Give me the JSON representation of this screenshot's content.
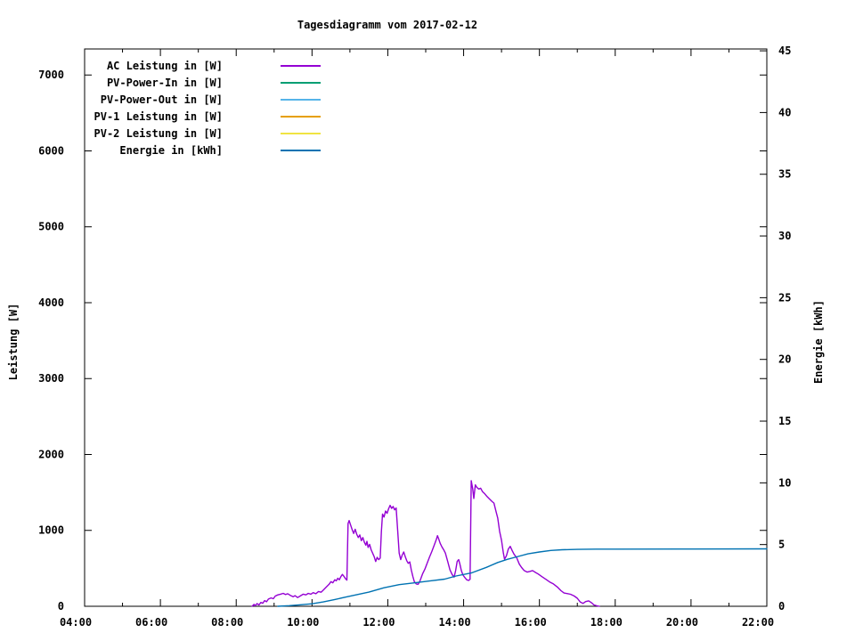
{
  "chart_data": {
    "type": "line",
    "title": "Tagesdiagramm vom 2017-02-12",
    "x_axis": {
      "range": [
        4,
        22
      ],
      "major_ticks": [
        {
          "h": 4,
          "label": "04:00"
        },
        {
          "h": 6,
          "label": "06:00"
        },
        {
          "h": 8,
          "label": "08:00"
        },
        {
          "h": 10,
          "label": "10:00"
        },
        {
          "h": 12,
          "label": "12:00"
        },
        {
          "h": 14,
          "label": "14:00"
        },
        {
          "h": 16,
          "label": "16:00"
        },
        {
          "h": 18,
          "label": "18:00"
        },
        {
          "h": 20,
          "label": "20:00"
        },
        {
          "h": 22,
          "label": "22:00"
        }
      ],
      "minor_ticks": [
        5,
        7,
        9,
        11,
        13,
        15,
        17,
        19,
        21
      ]
    },
    "y_axis": {
      "label": "Leistung [W]",
      "range": [
        0,
        7343
      ],
      "ticks": [
        0,
        1000,
        2000,
        3000,
        4000,
        5000,
        6000,
        7000
      ]
    },
    "y2_axis": {
      "label": "Energie [kWh]",
      "range": [
        0,
        45.15
      ],
      "ticks": [
        0,
        5,
        10,
        15,
        20,
        25,
        30,
        35,
        40,
        45
      ]
    },
    "grid": false,
    "legend_position": "top-left",
    "series": [
      {
        "name": "AC Leistung in [W]",
        "color": "#9400d3",
        "axis": "y",
        "points": [
          [
            8.42,
            0
          ],
          [
            8.47,
            25
          ],
          [
            8.5,
            8
          ],
          [
            8.55,
            35
          ],
          [
            8.6,
            18
          ],
          [
            8.65,
            50
          ],
          [
            8.7,
            40
          ],
          [
            8.75,
            75
          ],
          [
            8.8,
            60
          ],
          [
            8.85,
            95
          ],
          [
            8.92,
            110
          ],
          [
            8.98,
            100
          ],
          [
            9.03,
            135
          ],
          [
            9.1,
            150
          ],
          [
            9.17,
            160
          ],
          [
            9.24,
            170
          ],
          [
            9.3,
            155
          ],
          [
            9.36,
            165
          ],
          [
            9.42,
            145
          ],
          [
            9.5,
            125
          ],
          [
            9.55,
            140
          ],
          [
            9.62,
            115
          ],
          [
            9.7,
            140
          ],
          [
            9.77,
            160
          ],
          [
            9.84,
            150
          ],
          [
            9.9,
            170
          ],
          [
            9.97,
            160
          ],
          [
            10.03,
            180
          ],
          [
            10.1,
            165
          ],
          [
            10.17,
            195
          ],
          [
            10.24,
            185
          ],
          [
            10.3,
            215
          ],
          [
            10.38,
            255
          ],
          [
            10.45,
            290
          ],
          [
            10.5,
            325
          ],
          [
            10.55,
            310
          ],
          [
            10.6,
            350
          ],
          [
            10.64,
            335
          ],
          [
            10.68,
            370
          ],
          [
            10.72,
            350
          ],
          [
            10.76,
            390
          ],
          [
            10.8,
            420
          ],
          [
            10.84,
            395
          ],
          [
            10.88,
            365
          ],
          [
            10.92,
            345
          ],
          [
            10.95,
            1090
          ],
          [
            10.98,
            1130
          ],
          [
            11.02,
            1070
          ],
          [
            11.06,
            1010
          ],
          [
            11.1,
            960
          ],
          [
            11.14,
            1015
          ],
          [
            11.18,
            950
          ],
          [
            11.22,
            905
          ],
          [
            11.26,
            940
          ],
          [
            11.3,
            865
          ],
          [
            11.34,
            905
          ],
          [
            11.38,
            845
          ],
          [
            11.42,
            805
          ],
          [
            11.45,
            855
          ],
          [
            11.48,
            775
          ],
          [
            11.52,
            815
          ],
          [
            11.56,
            745
          ],
          [
            11.6,
            700
          ],
          [
            11.64,
            655
          ],
          [
            11.68,
            590
          ],
          [
            11.72,
            645
          ],
          [
            11.76,
            615
          ],
          [
            11.8,
            635
          ],
          [
            11.83,
            980
          ],
          [
            11.86,
            1215
          ],
          [
            11.9,
            1175
          ],
          [
            11.94,
            1255
          ],
          [
            11.98,
            1225
          ],
          [
            12.02,
            1285
          ],
          [
            12.06,
            1330
          ],
          [
            12.1,
            1290
          ],
          [
            12.14,
            1315
          ],
          [
            12.18,
            1270
          ],
          [
            12.22,
            1295
          ],
          [
            12.26,
            1000
          ],
          [
            12.3,
            700
          ],
          [
            12.34,
            615
          ],
          [
            12.38,
            675
          ],
          [
            12.42,
            715
          ],
          [
            12.46,
            655
          ],
          [
            12.5,
            600
          ],
          [
            12.54,
            565
          ],
          [
            12.58,
            585
          ],
          [
            12.62,
            480
          ],
          [
            12.66,
            395
          ],
          [
            12.7,
            325
          ],
          [
            12.75,
            295
          ],
          [
            12.8,
            290
          ],
          [
            12.85,
            335
          ],
          [
            12.92,
            430
          ],
          [
            12.98,
            490
          ],
          [
            13.04,
            570
          ],
          [
            13.1,
            650
          ],
          [
            13.16,
            720
          ],
          [
            13.22,
            800
          ],
          [
            13.28,
            880
          ],
          [
            13.31,
            930
          ],
          [
            13.34,
            890
          ],
          [
            13.38,
            830
          ],
          [
            13.43,
            780
          ],
          [
            13.48,
            740
          ],
          [
            13.52,
            700
          ],
          [
            13.58,
            590
          ],
          [
            13.64,
            480
          ],
          [
            13.7,
            415
          ],
          [
            13.75,
            385
          ],
          [
            13.79,
            470
          ],
          [
            13.83,
            590
          ],
          [
            13.87,
            615
          ],
          [
            13.9,
            560
          ],
          [
            13.94,
            470
          ],
          [
            13.98,
            415
          ],
          [
            14.03,
            380
          ],
          [
            14.08,
            350
          ],
          [
            14.13,
            340
          ],
          [
            14.17,
            355
          ],
          [
            14.2,
            1655
          ],
          [
            14.24,
            1545
          ],
          [
            14.27,
            1420
          ],
          [
            14.31,
            1600
          ],
          [
            14.35,
            1565
          ],
          [
            14.4,
            1545
          ],
          [
            14.45,
            1555
          ],
          [
            14.5,
            1510
          ],
          [
            14.56,
            1480
          ],
          [
            14.62,
            1445
          ],
          [
            14.68,
            1415
          ],
          [
            14.74,
            1385
          ],
          [
            14.8,
            1360
          ],
          [
            14.85,
            1260
          ],
          [
            14.9,
            1160
          ],
          [
            14.95,
            985
          ],
          [
            15.0,
            870
          ],
          [
            15.05,
            700
          ],
          [
            15.08,
            620
          ],
          [
            15.13,
            665
          ],
          [
            15.18,
            755
          ],
          [
            15.23,
            790
          ],
          [
            15.28,
            735
          ],
          [
            15.33,
            685
          ],
          [
            15.4,
            640
          ],
          [
            15.47,
            555
          ],
          [
            15.53,
            510
          ],
          [
            15.6,
            470
          ],
          [
            15.68,
            450
          ],
          [
            15.75,
            460
          ],
          [
            15.82,
            470
          ],
          [
            15.88,
            450
          ],
          [
            15.97,
            425
          ],
          [
            16.07,
            390
          ],
          [
            16.17,
            355
          ],
          [
            16.27,
            320
          ],
          [
            16.37,
            295
          ],
          [
            16.47,
            255
          ],
          [
            16.57,
            205
          ],
          [
            16.65,
            175
          ],
          [
            16.73,
            168
          ],
          [
            16.82,
            158
          ],
          [
            16.92,
            135
          ],
          [
            17.0,
            105
          ],
          [
            17.08,
            55
          ],
          [
            17.15,
            38
          ],
          [
            17.22,
            62
          ],
          [
            17.3,
            72
          ],
          [
            17.37,
            48
          ],
          [
            17.44,
            18
          ],
          [
            17.52,
            6
          ],
          [
            17.58,
            0
          ]
        ]
      },
      {
        "name": "PV-Power-In in [W]",
        "color": "#009e73",
        "axis": "y",
        "points": []
      },
      {
        "name": "PV-Power-Out in [W]",
        "color": "#56b4e9",
        "axis": "y",
        "points": []
      },
      {
        "name": "PV-1 Leistung in [W]",
        "color": "#e69f00",
        "axis": "y",
        "points": []
      },
      {
        "name": "PV-2 Leistung in [W]",
        "color": "#f0e442",
        "axis": "y",
        "points": []
      },
      {
        "name": "Energie in [kWh]",
        "color": "#0072b2",
        "axis": "y2",
        "points": [
          [
            9.1,
            0
          ],
          [
            9.4,
            0.05
          ],
          [
            9.7,
            0.12
          ],
          [
            10.0,
            0.2
          ],
          [
            10.3,
            0.35
          ],
          [
            10.6,
            0.55
          ],
          [
            10.9,
            0.75
          ],
          [
            11.2,
            0.95
          ],
          [
            11.5,
            1.15
          ],
          [
            11.9,
            1.5
          ],
          [
            12.3,
            1.75
          ],
          [
            12.7,
            1.9
          ],
          [
            13.1,
            2.05
          ],
          [
            13.5,
            2.2
          ],
          [
            13.8,
            2.45
          ],
          [
            14.2,
            2.7
          ],
          [
            14.6,
            3.15
          ],
          [
            14.9,
            3.55
          ],
          [
            15.15,
            3.8
          ],
          [
            15.4,
            4.0
          ],
          [
            15.7,
            4.25
          ],
          [
            16.0,
            4.4
          ],
          [
            16.3,
            4.52
          ],
          [
            16.6,
            4.58
          ],
          [
            17.0,
            4.61
          ],
          [
            17.5,
            4.63
          ],
          [
            18.0,
            4.63
          ],
          [
            20.0,
            4.64
          ],
          [
            22.0,
            4.65
          ]
        ]
      }
    ]
  }
}
